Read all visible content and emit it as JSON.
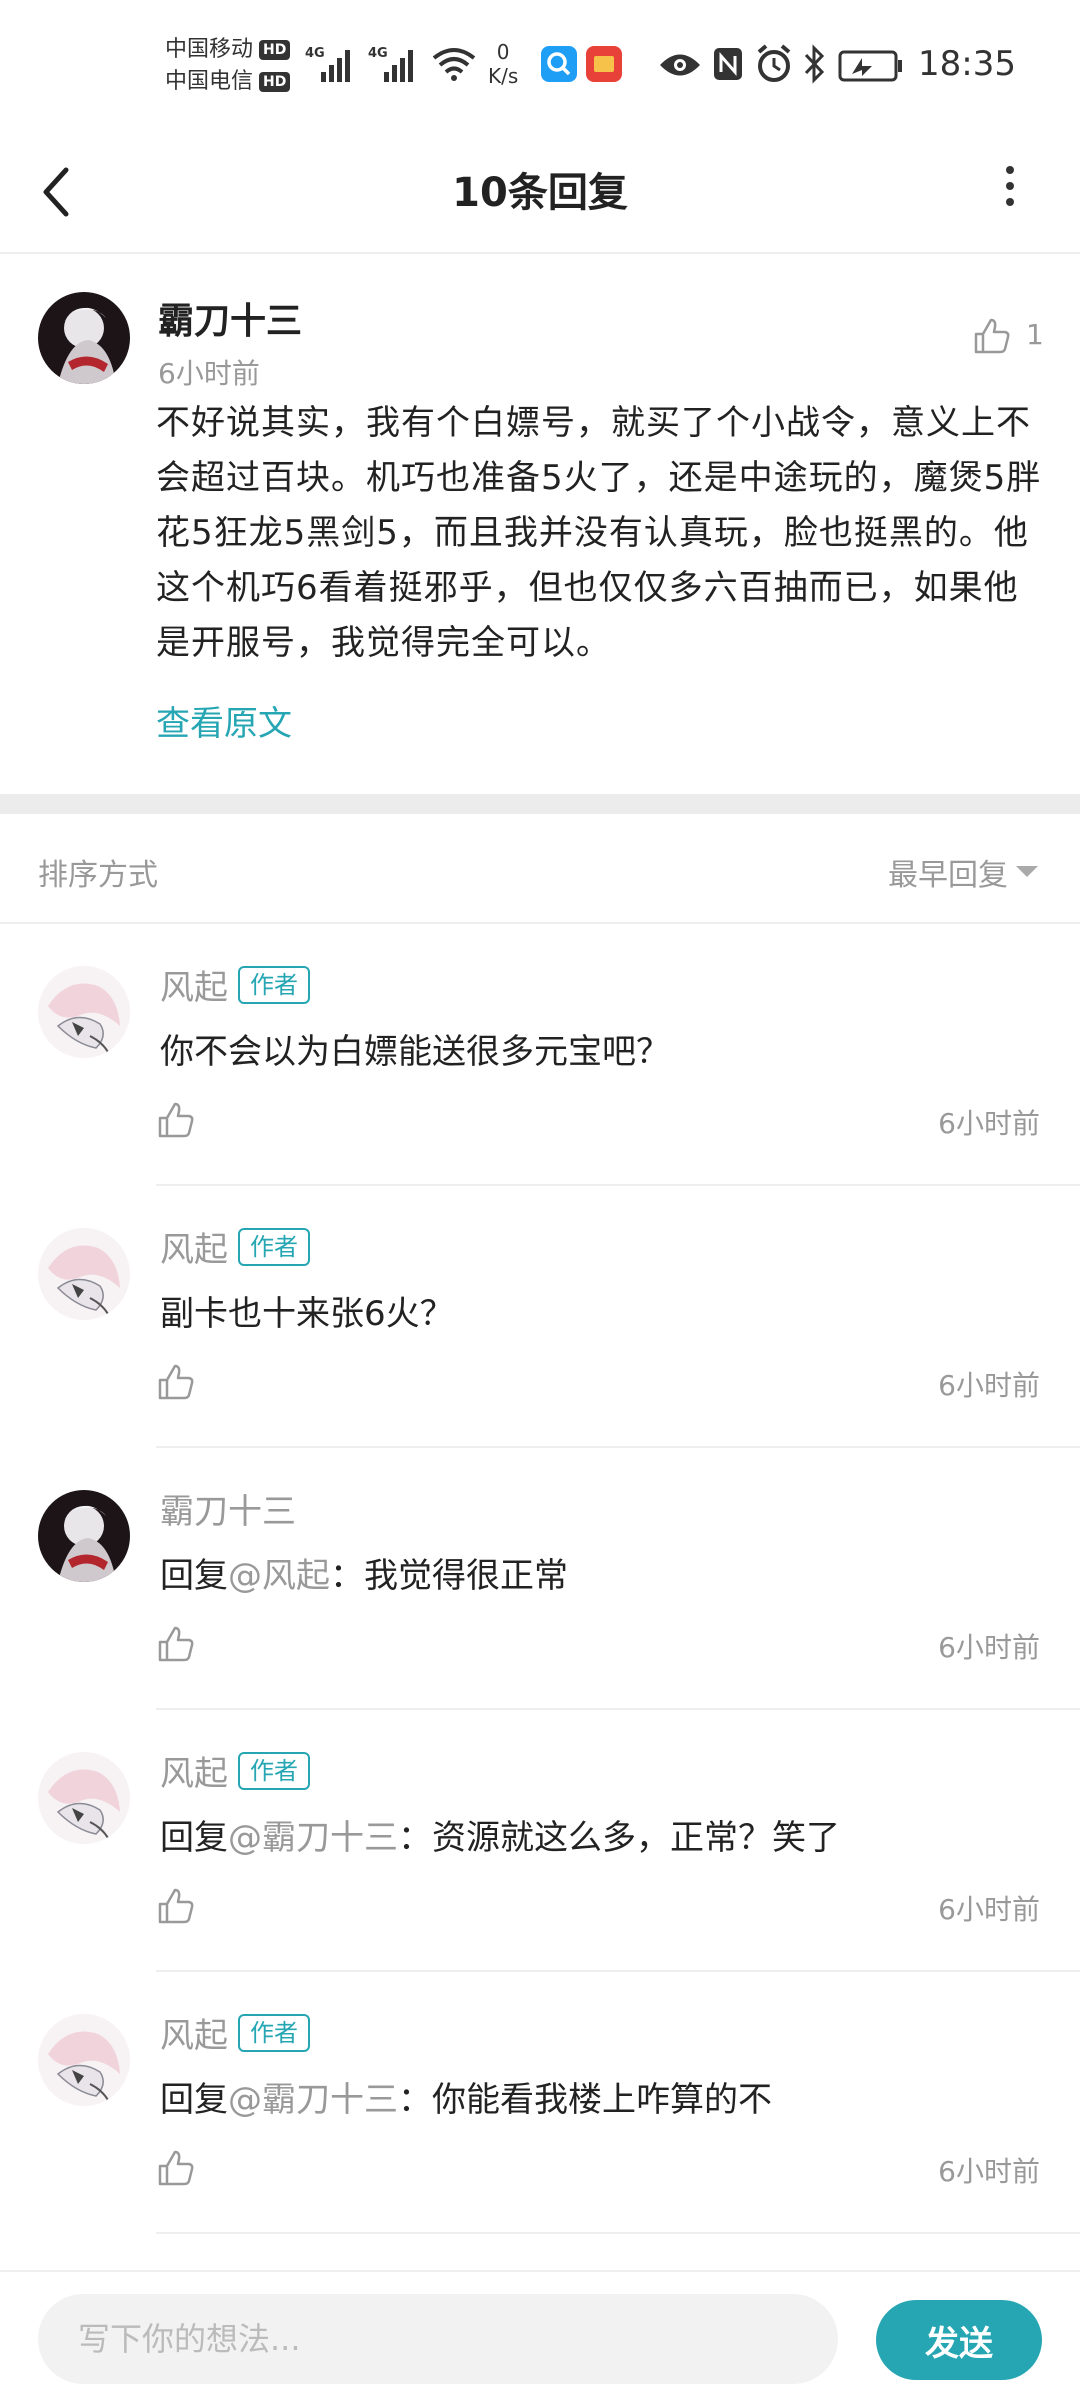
{
  "status_bar": {
    "carrier1": "中国移动",
    "carrier2": "中国电信",
    "hd": "HD",
    "net1": "4G",
    "net2": "4G",
    "speed_value": "0",
    "speed_unit": "K/s",
    "time": "18:35",
    "icons": [
      "wifi-icon",
      "search-app-icon",
      "news-app-icon",
      "eye-icon",
      "nfc-icon",
      "alarm-icon",
      "bluetooth-icon",
      "battery-icon"
    ]
  },
  "header": {
    "title": "10条回复",
    "back_icon": "back-arrow-icon",
    "more_icon": "more-vertical-icon"
  },
  "main_comment": {
    "author": "霸刀十三",
    "time": "6小时前",
    "likes": "1",
    "content": "不好说其实，我有个白嫖号，就买了个小战令，意义上不会超过百块。机巧也准备5火了，还是中途玩的，魔煲5胖花5狂龙5黑剑5，而且我并没有认真玩，脸也挺黑的。他这个机巧6看着挺邪乎，但也仅仅多六百抽而已，如果他是开服号，我觉得完全可以。",
    "view_original": "查看原文"
  },
  "sort": {
    "label": "排序方式",
    "value": "最早回复"
  },
  "replies": [
    {
      "author": "风起",
      "tag": "作者",
      "prefix": "",
      "at": "",
      "text": "你不会以为白嫖能送很多元宝吧？",
      "time": "6小时前",
      "avatar": "light"
    },
    {
      "author": "风起",
      "tag": "作者",
      "prefix": "",
      "at": "",
      "text": "副卡也十来张6火？",
      "time": "6小时前",
      "avatar": "light"
    },
    {
      "author": "霸刀十三",
      "tag": "",
      "prefix": "回复",
      "at": "@风起",
      "text": "：我觉得很正常",
      "time": "6小时前",
      "avatar": "dark"
    },
    {
      "author": "风起",
      "tag": "作者",
      "prefix": "回复",
      "at": "@霸刀十三",
      "text": "：资源就这么多，正常？笑了",
      "time": "6小时前",
      "avatar": "light"
    },
    {
      "author": "风起",
      "tag": "作者",
      "prefix": "回复",
      "at": "@霸刀十三",
      "text": "：你能看我楼上咋算的不",
      "time": "6小时前",
      "avatar": "light"
    }
  ],
  "composer": {
    "placeholder": "写下你的想法...",
    "send_label": "发送"
  },
  "colors": {
    "accent": "#26a6b3",
    "muted": "#999999",
    "divider": "#eeeeee"
  }
}
